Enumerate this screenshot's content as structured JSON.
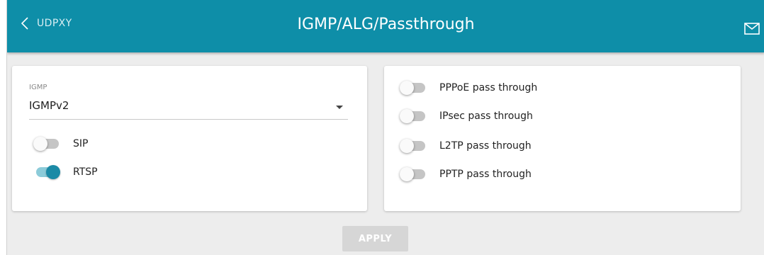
{
  "header": {
    "back_label": "UDPXY",
    "title": "IGMP/ALG/Passthrough",
    "back_icon": "chevron-left-icon",
    "mail_icon": "mail-icon",
    "color": "#0e8ea8"
  },
  "igmp": {
    "label": "IGMP",
    "value": "IGMPv2"
  },
  "alg": [
    {
      "label": "SIP",
      "on": false
    },
    {
      "label": "RTSP",
      "on": true
    }
  ],
  "passthrough": [
    {
      "label": "PPPoE pass through",
      "on": false
    },
    {
      "label": "IPsec pass through",
      "on": false
    },
    {
      "label": "L2TP pass through",
      "on": false
    },
    {
      "label": "PPTP pass through",
      "on": false
    }
  ],
  "apply_label": "APPLY",
  "colors": {
    "accent": "#1b8aa6",
    "toggle_on_track": "#8ccbd9",
    "toggle_off_track": "#c5c5c5",
    "background": "#ededed",
    "button_disabled": "#d6d6d6"
  }
}
